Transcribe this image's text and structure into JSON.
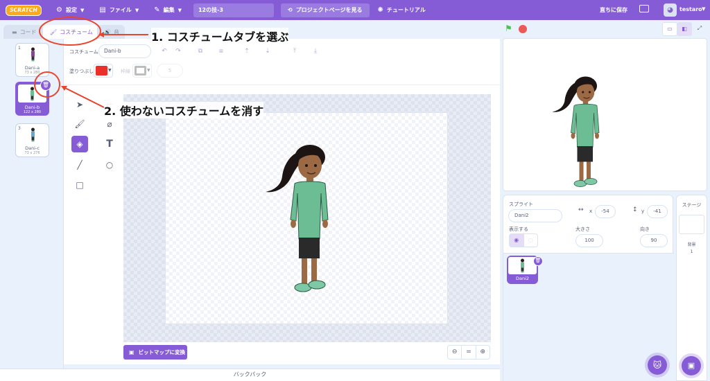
{
  "menubar": {
    "logo": "SCRATCH",
    "settings": "設定",
    "file": "ファイル",
    "edit": "編集",
    "project_title": "12の技-3",
    "see_project_page": "プロジェクトページを見る",
    "tutorials": "チュートリアル",
    "save_now": "直ちに保存",
    "username": "testaro"
  },
  "tabs": {
    "code": "コード",
    "costumes": "コスチューム",
    "sounds": "音"
  },
  "costumes": [
    {
      "num": "1",
      "name": "Dani-a",
      "size": "73 x 280"
    },
    {
      "num": "2",
      "name": "Dani-b",
      "size": "122 x 280"
    },
    {
      "num": "3",
      "name": "Dani-c",
      "size": "73 x 276"
    }
  ],
  "editor": {
    "costume_label": "コスチューム",
    "costume_name": "Dani-b",
    "fill_label": "塗りつぶし",
    "outline_label": "枠線",
    "stroke_value": "5",
    "fill_color": "#e9302a",
    "convert_bitmap": "ビットマップに変換",
    "zoom_equal": "="
  },
  "backpack": "バックパック",
  "sprite_info": {
    "sprite_label": "スプライト",
    "sprite_name": "Dani2",
    "x_label": "x",
    "x_value": "-54",
    "y_label": "y",
    "y_value": "-41",
    "show_label": "表示する",
    "size_label": "大きさ",
    "size_value": "100",
    "direction_label": "向き",
    "direction_value": "90"
  },
  "sprites": [
    {
      "name": "Dani2"
    }
  ],
  "stage_pane": {
    "label": "ステージ",
    "backdrop_label": "背景",
    "backdrop_count": "1"
  },
  "annotations": {
    "step1": "1.  コスチュームタブを選ぶ",
    "step2": "2.  使わないコスチュームを消す"
  },
  "colors": {
    "accent": "#855cd6",
    "annotation": "#e8452c"
  }
}
